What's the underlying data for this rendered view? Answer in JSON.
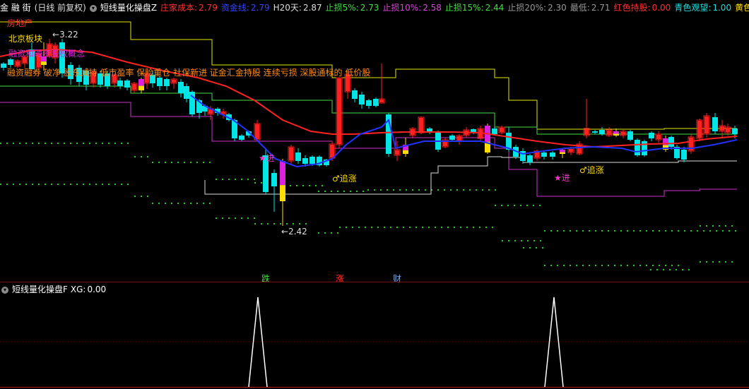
{
  "header": {
    "app": "金 融 街",
    "mode": "(日线 前复权)",
    "indicator": "短线量化操盘Z",
    "items": [
      {
        "label": "庄家成本:",
        "value": "2.79",
        "color": "#ff3030"
      },
      {
        "label": "资金线:",
        "value": "2.79",
        "color": "#3344ff"
      },
      {
        "label": "H20天:",
        "value": "2.87",
        "color": "#dddddd"
      },
      {
        "label": "止损5%:",
        "value": "2.73",
        "color": "#44dd44"
      },
      {
        "label": "止损10%:",
        "value": "2.58",
        "color": "#dd44dd"
      },
      {
        "label": "止损15%:",
        "value": "2.44",
        "color": "#44dd44"
      },
      {
        "label": "止损20%:",
        "value": "2.30",
        "color": "#999999"
      },
      {
        "label": "最低:",
        "value": "2.71",
        "color": "#999999"
      },
      {
        "label": "红色持股:",
        "value": "0.00",
        "color": "#ff3030"
      },
      {
        "label": "青色观望:",
        "value": "1.00",
        "color": "#22dddd"
      },
      {
        "label": "黄色低买",
        "value": "",
        "color": "#ffdd00"
      }
    ]
  },
  "tags": {
    "sector1": "房地产",
    "sector2": "北京板块",
    "sector3": "融资融券 破净 股东减持 低市盈率 保险重仓 社保新进 证金汇金持股 连续亏损 深股通标的 低价股",
    "concept": "融资和融资股权概念"
  },
  "annotations": {
    "high": "3.22",
    "low": "2.42",
    "buy1": "★进",
    "buy2": "★进",
    "chase1": "♂追涨",
    "chase2": "♂追涨",
    "die": "跌",
    "zhang": "涨",
    "cai": "财"
  },
  "sub_header": {
    "indicator": "短线量化操盘F",
    "xg_label": "XG:",
    "xg_value": "0.00"
  },
  "colors": {
    "up": "#ff2020",
    "down": "#00e5e5",
    "yellow": "#ffdd00",
    "magenta": "#dd22dd",
    "cost": "#ff2222",
    "fund": "#2233ff",
    "h20": "#e6e600",
    "stop5": "#44dd44",
    "stop10": "#cc33cc",
    "stop15": "#dddddd"
  }
}
